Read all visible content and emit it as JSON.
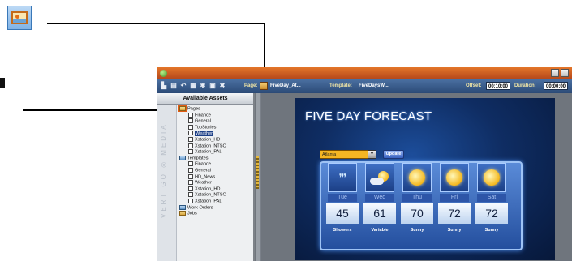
{
  "icons": {
    "image_callout": "image-icon",
    "titlebar_app": "app-icon",
    "page_icon": "image-icon",
    "folder": "folder-icon",
    "document": "document-icon"
  },
  "window": {
    "toolbar": {
      "page_label": "Page:",
      "page_value": "FiveDay_At...",
      "template_label": "Template:",
      "template_value": "FiveDaysW...",
      "offset_label": "Offset:",
      "offset_value": "00:10:00",
      "duration_label": "Duration:",
      "duration_value": "00:00:00"
    },
    "assets": {
      "title": "Available Assets",
      "brand_vertical": "VERTIGO ◎ MEDIA",
      "tree": [
        {
          "label": "Pages",
          "level": 1,
          "type": "folder",
          "highlight": true
        },
        {
          "label": "Finance",
          "level": 2,
          "type": "doc"
        },
        {
          "label": "General",
          "level": 2,
          "type": "doc"
        },
        {
          "label": "TopStories",
          "level": 2,
          "type": "doc"
        },
        {
          "label": "Weather",
          "level": 2,
          "type": "doc",
          "selected": true
        },
        {
          "label": "Xstation_HD",
          "level": 2,
          "type": "doc"
        },
        {
          "label": "Xstation_NTSC",
          "level": 2,
          "type": "doc"
        },
        {
          "label": "Xstation_PAL",
          "level": 2,
          "type": "doc"
        },
        {
          "label": "Templates",
          "level": 1,
          "type": "folder-blue"
        },
        {
          "label": "Finance",
          "level": 2,
          "type": "doc"
        },
        {
          "label": "General",
          "level": 2,
          "type": "doc"
        },
        {
          "label": "HD_News",
          "level": 2,
          "type": "doc"
        },
        {
          "label": "Weather",
          "level": 2,
          "type": "doc"
        },
        {
          "label": "Xstation_HD",
          "level": 2,
          "type": "doc"
        },
        {
          "label": "Xstation_NTSC",
          "level": 2,
          "type": "doc"
        },
        {
          "label": "Xstation_PAL",
          "level": 2,
          "type": "doc"
        },
        {
          "label": "Work Orders",
          "level": 1,
          "type": "folder-blue"
        },
        {
          "label": "Jobs",
          "level": 1,
          "type": "folder"
        }
      ]
    },
    "graphic": {
      "title": "FIVE DAY FORECAST",
      "location": "Atlanta",
      "update_label": "Update",
      "days": [
        {
          "name": "Tue",
          "temp": "45",
          "condition": "Showers",
          "icon": "rain-icon"
        },
        {
          "name": "Wed",
          "temp": "61",
          "condition": "Variable",
          "icon": "partly-cloudy-icon"
        },
        {
          "name": "Thu",
          "temp": "70",
          "condition": "Sunny",
          "icon": "sun-icon"
        },
        {
          "name": "Fri",
          "temp": "72",
          "condition": "Sunny",
          "icon": "sun-icon"
        },
        {
          "name": "Sat",
          "temp": "72",
          "condition": "Sunny",
          "icon": "sun-icon"
        }
      ]
    }
  },
  "colors": {
    "titlebar": "#c9561f",
    "toolbar": "#36598a",
    "selection": "#1c3f86",
    "forecast_bg": "#0f2d63"
  }
}
